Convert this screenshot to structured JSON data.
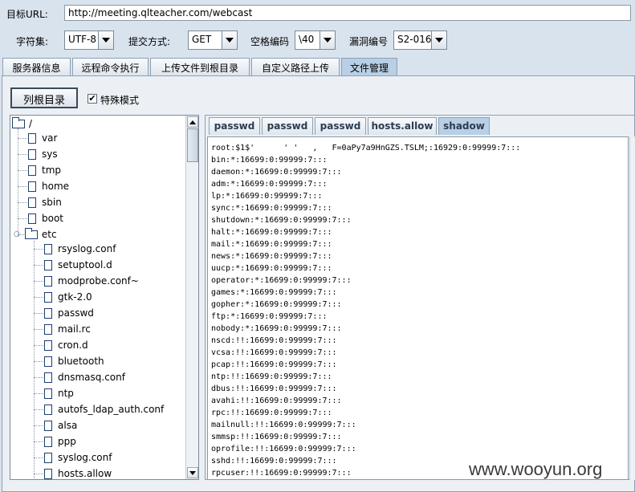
{
  "form": {
    "target_url_label": "目标URL:",
    "target_url_value": "http://meeting.qlteacher.com/webcast",
    "charset_label": "字符集:",
    "charset_value": "UTF-8",
    "method_label": "提交方式:",
    "method_value": "GET",
    "space_encoding_label": "空格编码",
    "space_encoding_value": "\\40",
    "vuln_id_label": "漏洞编号",
    "vuln_id_value": "S2-016"
  },
  "tabs": [
    {
      "label": "服务器信息"
    },
    {
      "label": "远程命令执行"
    },
    {
      "label": "上传文件到根目录"
    },
    {
      "label": "自定义路径上传"
    },
    {
      "label": "文件管理"
    }
  ],
  "active_tab": "文件管理",
  "file_manager": {
    "list_root_button": "列根目录",
    "special_mode_label": "特殊模式",
    "special_mode_checked": "✔",
    "tree": {
      "root": "/",
      "top_items": [
        "var",
        "sys",
        "tmp",
        "home",
        "sbin",
        "boot"
      ],
      "etc_folder": "etc",
      "etc_items": [
        "rsyslog.conf",
        "setuptool.d",
        "modprobe.conf~",
        "gtk-2.0",
        "passwd",
        "mail.rc",
        "cron.d",
        "bluetooth",
        "dnsmasq.conf",
        "ntp",
        "autofs_ldap_auth.conf",
        "alsa",
        "ppp",
        "syslog.conf",
        "hosts.allow"
      ]
    },
    "file_tabs": [
      "passwd",
      "passwd",
      "passwd",
      "hosts.allow",
      "shadow"
    ],
    "active_file_tab": "shadow",
    "file_lines": [
      "root:$1$'      ' '   ,   F=0aPy7a9HnGZS.TSLM;:16929:0:99999:7:::",
      "bin:*:16699:0:99999:7:::",
      "daemon:*:16699:0:99999:7:::",
      "adm:*:16699:0:99999:7:::",
      "lp:*:16699:0:99999:7:::",
      "sync:*:16699:0:99999:7:::",
      "shutdown:*:16699:0:99999:7:::",
      "halt:*:16699:0:99999:7:::",
      "mail:*:16699:0:99999:7:::",
      "news:*:16699:0:99999:7:::",
      "uucp:*:16699:0:99999:7:::",
      "operator:*:16699:0:99999:7:::",
      "games:*:16699:0:99999:7:::",
      "gopher:*:16699:0:99999:7:::",
      "ftp:*:16699:0:99999:7:::",
      "nobody:*:16699:0:99999:7:::",
      "nscd:!!:16699:0:99999:7:::",
      "vcsa:!!:16699:0:99999:7:::",
      "pcap:!!:16699:0:99999:7:::",
      "ntp:!!:16699:0:99999:7:::",
      "dbus:!!:16699:0:99999:7:::",
      "avahi:!!:16699:0:99999:7:::",
      "rpc:!!:16699:0:99999:7:::",
      "mailnull:!!:16699:0:99999:7:::",
      "smmsp:!!:16699:0:99999:7:::",
      "oprofile:!!:16699:0:99999:7:::",
      "sshd:!!:16699:0:99999:7:::",
      "rpcuser:!!:16699:0:99999:7:::"
    ]
  },
  "watermark": "www.wooyun.org"
}
